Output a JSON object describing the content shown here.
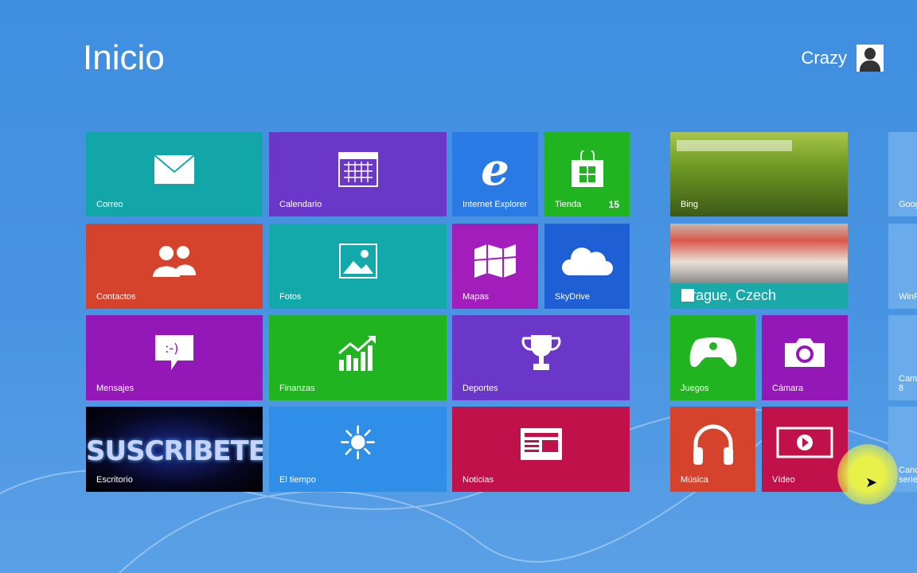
{
  "header": {
    "title": "Inicio",
    "user_name": "Crazy"
  },
  "tiles": {
    "correo": {
      "label": "Correo",
      "color": "#13a6a9"
    },
    "calendario": {
      "label": "Calendario",
      "color": "#6b37c8"
    },
    "ie": {
      "label": "Internet Explorer",
      "color": "#2a7ae6"
    },
    "tienda": {
      "label": "Tienda",
      "badge": "15",
      "color": "#20b520"
    },
    "bing": {
      "label": "Bing"
    },
    "contactos": {
      "label": "Contactos",
      "color": "#d6432c"
    },
    "fotos": {
      "label": "Fotos",
      "color": "#13a8aa"
    },
    "mapas": {
      "label": "Mapas",
      "color": "#a31cbc"
    },
    "skydrive": {
      "label": "SkyDrive",
      "color": "#1f5fd6"
    },
    "viajes": {
      "label": "Prague, Czech"
    },
    "mensajes": {
      "label": "Mensajes",
      "color": "#9418b8"
    },
    "finanzas": {
      "label": "Finanzas",
      "color": "#20b520"
    },
    "deportes": {
      "label": "Deportes",
      "color": "#6b37c8"
    },
    "juegos": {
      "label": "Juegos",
      "color": "#20b520"
    },
    "camara": {
      "label": "Cámara",
      "color": "#9418b8"
    },
    "escritorio": {
      "label": "Escritorio",
      "image_text": "SUSCRIBETE"
    },
    "tiempo": {
      "label": "El tiempo",
      "color": "#2f8fe8"
    },
    "noticias": {
      "label": "Noticias",
      "color": "#c0114b"
    },
    "musica": {
      "label": "Música",
      "color": "#d6432c"
    },
    "video": {
      "label": "Vídeo",
      "color": "#c0114b"
    },
    "right_col": [
      "Goog",
      "WinF",
      "Cam 8",
      "Canc serie"
    ]
  }
}
